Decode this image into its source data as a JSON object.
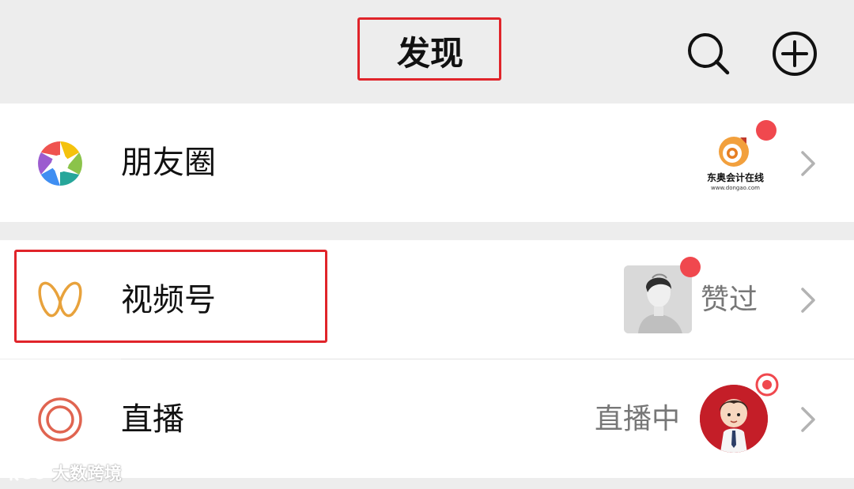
{
  "header": {
    "title": "发现",
    "search_icon": "search-icon",
    "add_icon": "plus-circle-icon"
  },
  "rows": {
    "moments": {
      "label": "朋友圈",
      "icon": "camera-aperture-icon",
      "thumb_name": "东奥会计在线",
      "thumb_url": "www.dongao.com",
      "has_red_dot": true
    },
    "channels": {
      "label": "视频号",
      "icon": "channels-butterfly-icon",
      "status": "赞过",
      "has_red_dot": true
    },
    "live": {
      "label": "直播",
      "icon": "live-ring-icon",
      "status": "直播中"
    }
  },
  "watermark": {
    "text": "大数跨境"
  },
  "colors": {
    "highlight_box": "#e0242a",
    "red_dot": "#f0484e",
    "channels_icon": "#e8a23c",
    "live_icon": "#e06450",
    "background": "#ededed"
  }
}
